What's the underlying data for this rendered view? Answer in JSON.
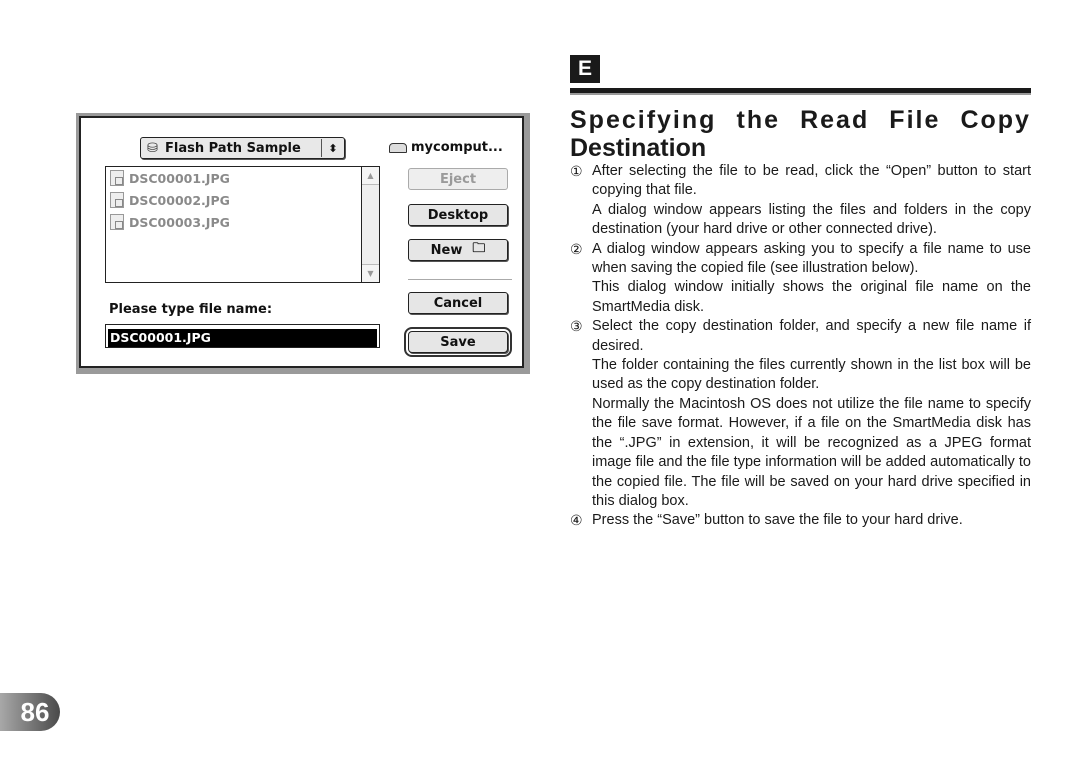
{
  "dialog": {
    "folder_popup": {
      "icon": "floppy-disk-icon",
      "label": "Flash Path Sample",
      "arrows": "⬍"
    },
    "drive": {
      "icon": "hard-drive-icon",
      "label": "mycomput..."
    },
    "files": [
      {
        "name": "DSC00001.JPG",
        "icon": "jpeg-file-icon"
      },
      {
        "name": "DSC00002.JPG",
        "icon": "jpeg-file-icon"
      },
      {
        "name": "DSC00003.JPG",
        "icon": "jpeg-file-icon"
      }
    ],
    "buttons": {
      "eject": "Eject",
      "desktop": "Desktop",
      "new": "New",
      "cancel": "Cancel",
      "save": "Save"
    },
    "prompt": "Please type file name:",
    "filename_value": "DSC00001.JPG"
  },
  "section": {
    "badge": "E",
    "title_line1": [
      "Specifying",
      "the",
      "Read",
      "File",
      "Copy"
    ],
    "title_line2": "Destination"
  },
  "steps": [
    {
      "num": "①",
      "paragraphs": [
        "After selecting the file to be read, click the “Open” button to start copying that file.",
        "A dialog window appears listing the files and folders in the copy destination (your hard drive or other connected drive)."
      ]
    },
    {
      "num": "②",
      "paragraphs": [
        "A dialog window appears asking you to specify a file name to use when saving the copied file (see illustration below).",
        "This dialog window initially shows the original file name on the SmartMedia disk."
      ]
    },
    {
      "num": "③",
      "paragraphs": [
        "Select the copy destination folder, and specify a new file name if desired.",
        "The folder containing the files currently shown in the list box will be used as the copy destination folder.",
        "Normally the Macintosh OS does not utilize the file name to specify the file save format. However, if a file on the SmartMedia disk has the “.JPG” in extension, it will be recognized as a JPEG format image file and the file type information will be added automatically to the copied file. The file will be saved on your hard drive specified in this dialog box."
      ]
    },
    {
      "num": "④",
      "paragraphs": [
        "Press the “Save” button to save the file to your hard drive."
      ]
    }
  ],
  "page_number": "86"
}
